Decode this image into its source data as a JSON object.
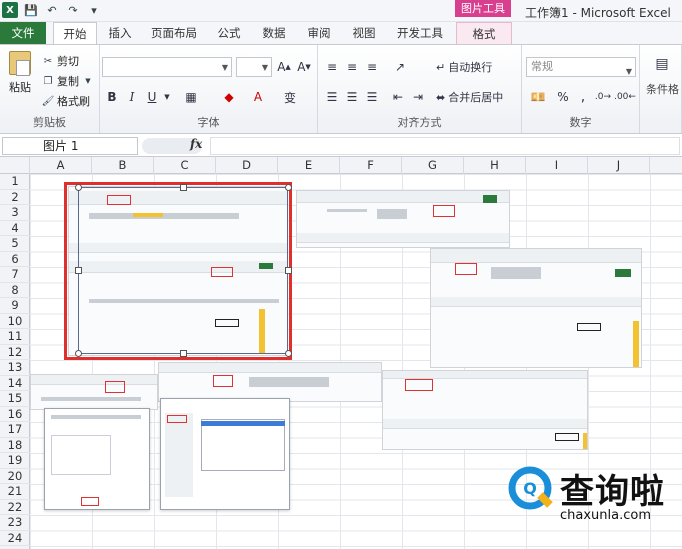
{
  "window": {
    "title": "工作簿1 - Microsoft Excel",
    "context_tab": "图片工具"
  },
  "tabs": [
    "文件",
    "开始",
    "插入",
    "页面布局",
    "公式",
    "数据",
    "审阅",
    "视图",
    "开发工具",
    "格式"
  ],
  "ribbon": {
    "clipboard": {
      "label": "剪贴板",
      "paste": "粘贴",
      "cut": "剪切",
      "copy": "复制",
      "format_painter": "格式刷"
    },
    "font": {
      "label": "字体"
    },
    "alignment": {
      "label": "对齐方式",
      "wrap_text": "自动换行",
      "merge_center": "合并后居中"
    },
    "number": {
      "label": "数字",
      "format_value": "常规"
    },
    "styles": {
      "conditional_format": "条件格"
    }
  },
  "formula_bar": {
    "name_box": "图片 1",
    "fx": "fx",
    "formula": ""
  },
  "columns": [
    "A",
    "B",
    "C",
    "D",
    "E",
    "F",
    "G",
    "H",
    "I",
    "J"
  ],
  "rows": [
    "1",
    "2",
    "3",
    "4",
    "5",
    "6",
    "7",
    "8",
    "9",
    "10",
    "11",
    "12",
    "13",
    "14",
    "15",
    "16",
    "17",
    "18",
    "19",
    "20",
    "21",
    "22",
    "23",
    "24"
  ],
  "watermark": {
    "brand": "查询啦",
    "domain": "chaxunla.com"
  },
  "colors": {
    "file_tab": "#2b7a3b",
    "picture_tools": "#d93f8f",
    "selection_border": "#e0302e",
    "watermark_blue": "#1a8ed8"
  }
}
